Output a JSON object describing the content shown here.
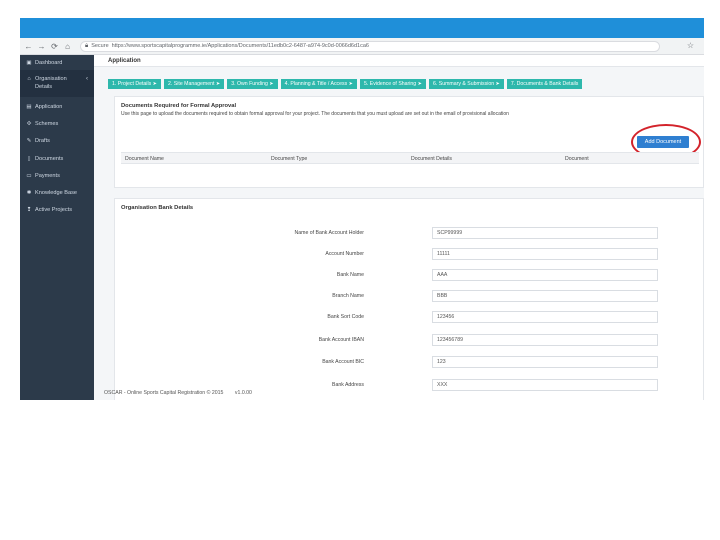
{
  "browser": {
    "secure_label": "Secure",
    "url": "https://www.sportscapitalprogramme.ie/Applications/Documents/11edb0c2-6487-a974-9c0d-0066d6d1ca6",
    "back_icon": "back-arrow-icon",
    "forward_icon": "forward-arrow-icon",
    "reload_icon": "reload-icon",
    "home_icon": "home-icon",
    "bookmark_icon": "star-icon"
  },
  "sidebar": {
    "items": [
      {
        "label": "Dashboard",
        "icon": "dashboard-icon"
      },
      {
        "label": "Organisation Details",
        "icon": "organisation-icon"
      },
      {
        "label": "Application",
        "icon": "application-icon"
      },
      {
        "label": "Schemes",
        "icon": "schemes-icon"
      },
      {
        "label": "Drafts",
        "icon": "drafts-icon"
      },
      {
        "label": "Documents",
        "icon": "documents-icon"
      },
      {
        "label": "Payments",
        "icon": "payments-icon"
      },
      {
        "label": "Knowledge Base",
        "icon": "knowledge-base-icon"
      },
      {
        "label": "Active Projects",
        "icon": "active-projects-icon"
      }
    ]
  },
  "main": {
    "title": "Application",
    "steps": [
      "1. Project Details ➤",
      "2. Site Management ➤",
      "3. Own Funding ➤",
      "4. Planning & Title / Access ➤",
      "5. Evidence of Sharing ➤",
      "6. Summary & Submission ➤",
      "7. Documents & Bank Details"
    ],
    "documents": {
      "title": "Documents Required for Formal Approval",
      "description": "Use this page to upload the documents required to obtain formal approval for your project. The documents that you must upload are set out in the email of provisional allocation",
      "add_button": "Add Document",
      "columns": [
        "Document Name",
        "Document Type",
        "Document Details",
        "Document"
      ]
    },
    "bank": {
      "title": "Organisation Bank Details",
      "fields": [
        {
          "label": "Name of Bank Account Holder",
          "value": "SCP99999"
        },
        {
          "label": "Account Number",
          "value": "11111"
        },
        {
          "label": "Bank Name",
          "value": "AAA"
        },
        {
          "label": "Branch Name",
          "value": "BBB"
        },
        {
          "label": "Bank Sort Code",
          "value": "123456"
        },
        {
          "label": "Bank Account IBAN",
          "value": "123456789"
        },
        {
          "label": "Bank Account BIC",
          "value": "123"
        },
        {
          "label": "Bank Address",
          "value": "XXX"
        }
      ]
    }
  },
  "footer": {
    "text": "OSCAR - Online Sports Capital Registration © 2015",
    "version": "v1.0.00"
  },
  "colors": {
    "accent_band": "#1f8fd9",
    "sidebar": "#2c3a4a",
    "step": "#2eb8ac",
    "primary_button": "#2f7fd1",
    "annotation_circle": "#d3232b"
  }
}
